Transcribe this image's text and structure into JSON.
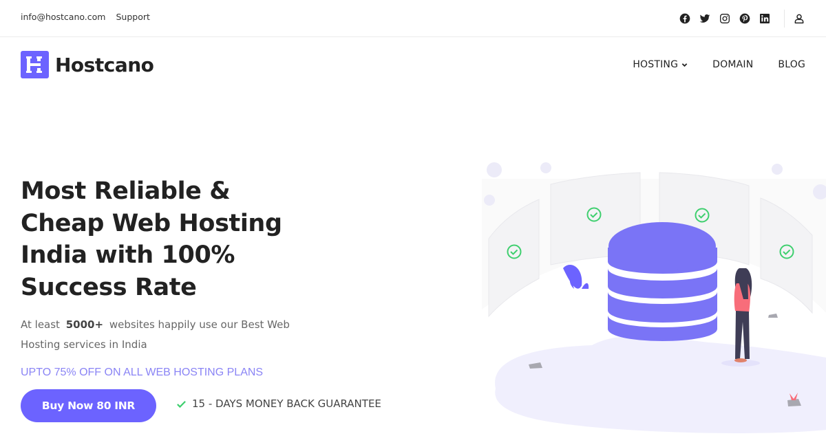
{
  "topbar": {
    "email": "info@hostcano.com",
    "support": "Support",
    "social": [
      "facebook-icon",
      "twitter-icon",
      "instagram-icon",
      "pinterest-icon",
      "linkedin-icon"
    ],
    "account_icon": "user-icon"
  },
  "header": {
    "logo_letter": "H",
    "logo_text": "Hostcano",
    "nav": [
      {
        "label": "HOSTING",
        "has_dropdown": true
      },
      {
        "label": "DOMAIN",
        "has_dropdown": false
      },
      {
        "label": "BLOG",
        "has_dropdown": false
      }
    ]
  },
  "hero": {
    "title_lines": [
      "Most Reliable &",
      "Cheap Web Hosting",
      "India with 100%",
      "Success Rate"
    ],
    "subtitle_pre": "At least",
    "subtitle_count": "5000+",
    "subtitle_post": "websites happily use our Best Web Hosting services in India",
    "promo": "UPTO 75% OFF ON ALL WEB HOSTING PLANS",
    "cta_label": "Buy Now 80 INR",
    "guarantee": "15 - DAYS MONEY BACK GUARANTEE"
  },
  "colors": {
    "brand": "#6c63ff",
    "promo": "#8a84f5",
    "check": "#3ecf6e",
    "text": "#222222"
  }
}
